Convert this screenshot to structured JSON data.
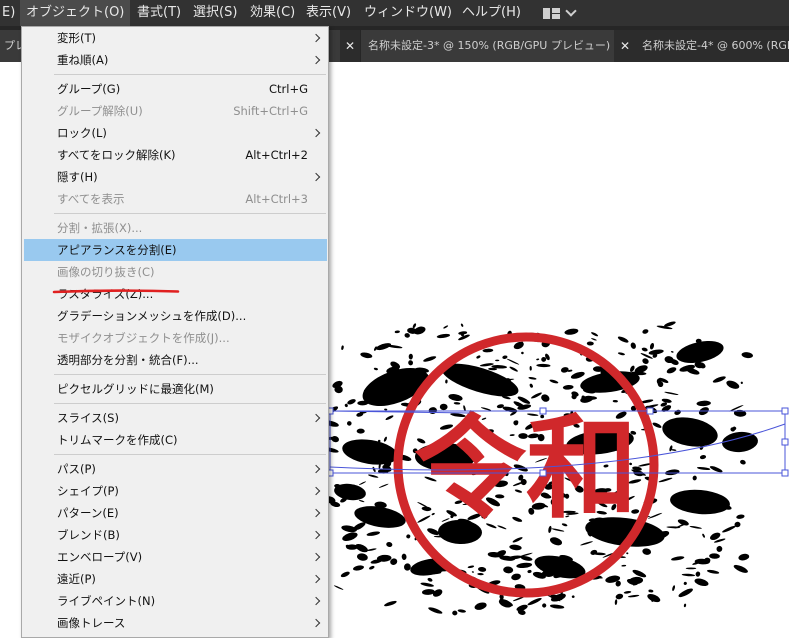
{
  "menubar": {
    "items": [
      {
        "label": "E)"
      },
      {
        "label": "オブジェクト(O)"
      },
      {
        "label": "書式(T)"
      },
      {
        "label": "選択(S)"
      },
      {
        "label": "効果(C)"
      },
      {
        "label": "表示(V)"
      },
      {
        "label": "ウィンドウ(W)"
      },
      {
        "label": "ヘルプ(H)"
      }
    ],
    "workspace_icon": "workspace-layout-icon"
  },
  "tabs": [
    {
      "label": "プレ"
    },
    {
      "label": ""
    },
    {
      "label": "名称未設定-3* @ 150% (RGB/GPU プレビュー)"
    },
    {
      "label": "名称未設定-4* @ 600% (RGB"
    }
  ],
  "object_menu": {
    "items": [
      {
        "label": "変形(T)",
        "shortcut": "",
        "disabled": false,
        "submenu": true
      },
      {
        "label": "重ね順(A)",
        "shortcut": "",
        "disabled": false,
        "submenu": true
      },
      {
        "label": "グループ(G)",
        "shortcut": "Ctrl+G",
        "disabled": false,
        "submenu": false
      },
      {
        "label": "グループ解除(U)",
        "shortcut": "Shift+Ctrl+G",
        "disabled": true,
        "submenu": false
      },
      {
        "label": "ロック(L)",
        "shortcut": "",
        "disabled": false,
        "submenu": true
      },
      {
        "label": "すべてをロック解除(K)",
        "shortcut": "Alt+Ctrl+2",
        "disabled": false,
        "submenu": false
      },
      {
        "label": "隠す(H)",
        "shortcut": "",
        "disabled": false,
        "submenu": true
      },
      {
        "label": "すべてを表示",
        "shortcut": "Alt+Ctrl+3",
        "disabled": true,
        "submenu": false
      },
      {
        "label": "分割・拡張(X)...",
        "shortcut": "",
        "disabled": true,
        "submenu": false
      },
      {
        "label": "アピアランスを分割(E)",
        "shortcut": "",
        "disabled": false,
        "submenu": false,
        "highlighted": true
      },
      {
        "label": "画像の切り抜き(C)",
        "shortcut": "",
        "disabled": true,
        "submenu": false
      },
      {
        "label": "ラスタライズ(Z)...",
        "shortcut": "",
        "disabled": false,
        "submenu": false
      },
      {
        "label": "グラデーションメッシュを作成(D)...",
        "shortcut": "",
        "disabled": false,
        "submenu": false
      },
      {
        "label": "モザイクオブジェクトを作成(J)...",
        "shortcut": "",
        "disabled": true,
        "submenu": false
      },
      {
        "label": "透明部分を分割・統合(F)...",
        "shortcut": "",
        "disabled": false,
        "submenu": false
      },
      {
        "label": "ピクセルグリッドに最適化(M)",
        "shortcut": "",
        "disabled": false,
        "submenu": false
      },
      {
        "label": "スライス(S)",
        "shortcut": "",
        "disabled": false,
        "submenu": true
      },
      {
        "label": "トリムマークを作成(C)",
        "shortcut": "",
        "disabled": false,
        "submenu": false
      },
      {
        "label": "パス(P)",
        "shortcut": "",
        "disabled": false,
        "submenu": true
      },
      {
        "label": "シェイプ(P)",
        "shortcut": "",
        "disabled": false,
        "submenu": true
      },
      {
        "label": "パターン(E)",
        "shortcut": "",
        "disabled": false,
        "submenu": true
      },
      {
        "label": "ブレンド(B)",
        "shortcut": "",
        "disabled": false,
        "submenu": true
      },
      {
        "label": "エンベロープ(V)",
        "shortcut": "",
        "disabled": false,
        "submenu": true
      },
      {
        "label": "遠近(P)",
        "shortcut": "",
        "disabled": false,
        "submenu": true
      },
      {
        "label": "ライブペイント(N)",
        "shortcut": "",
        "disabled": false,
        "submenu": true
      },
      {
        "label": "画像トレース",
        "shortcut": "",
        "disabled": false,
        "submenu": true
      }
    ]
  },
  "artwork": {
    "stamp_text": "令和",
    "stamp_color": "#d0282b",
    "selection_color": "#4a55d9",
    "annotation_color": "#e02020"
  },
  "colors": {
    "highlight": "#99c9ef",
    "menu_bg": "#f0f0f0",
    "menubar_bg": "#323232"
  }
}
